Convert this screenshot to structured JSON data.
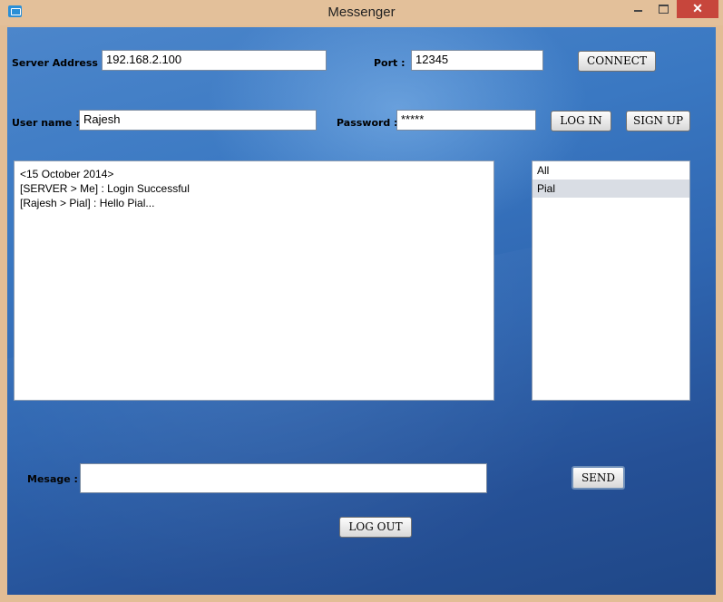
{
  "window": {
    "title": "Messenger"
  },
  "connection": {
    "server_label": "Server Address :",
    "server_value": "192.168.2.100",
    "port_label": "Port :",
    "port_value": "12345",
    "connect_label": "CONNECT"
  },
  "login": {
    "username_label": "User name :",
    "username_value": "Rajesh",
    "password_label": "Password :",
    "password_value": "*****",
    "login_label": "LOG IN",
    "signup_label": "SIGN UP"
  },
  "chat": {
    "lines": [
      "<15 October 2014>",
      "[SERVER > Me] : Login Successful",
      "[Rajesh > Pial] : Hello Pial..."
    ]
  },
  "users": {
    "items": [
      "All",
      "Pial"
    ],
    "selected": "Pial"
  },
  "compose": {
    "message_label": "Mesage :",
    "message_value": "",
    "send_label": "SEND"
  },
  "footer": {
    "logout_label": "LOG OUT"
  }
}
